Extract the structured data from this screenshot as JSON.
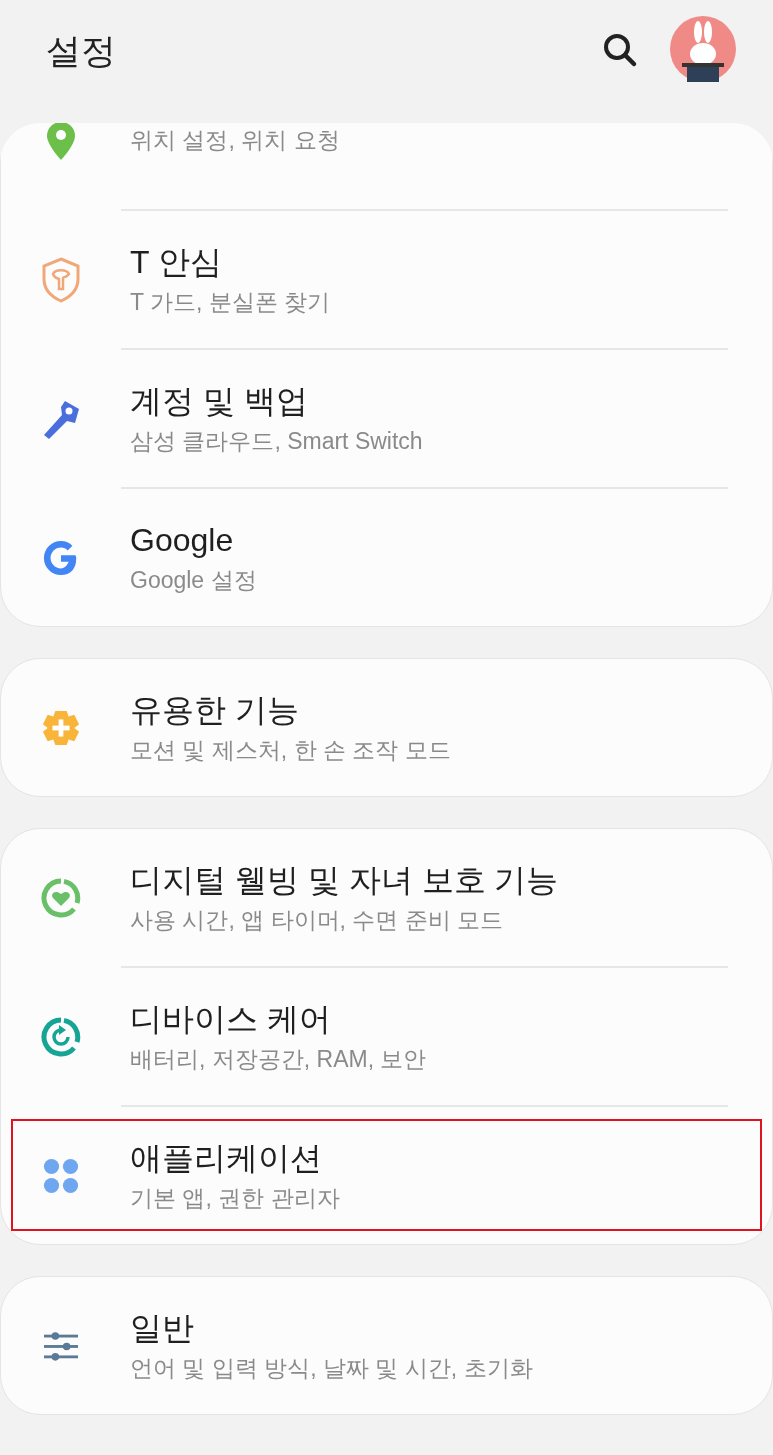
{
  "header": {
    "title": "설정"
  },
  "cards": [
    {
      "items": [
        {
          "kind": "location",
          "subtitle": "위치 설정, 위치 요청",
          "highlighted": false
        },
        {
          "kind": "shield",
          "title": "T 안심",
          "subtitle": "T 가드, 분실폰 찾기",
          "highlighted": false
        },
        {
          "kind": "key",
          "title": "계정 및 백업",
          "subtitle": "삼성 클라우드, Smart Switch",
          "highlighted": false
        },
        {
          "kind": "google",
          "title": "Google",
          "subtitle": "Google 설정",
          "highlighted": false
        }
      ]
    },
    {
      "items": [
        {
          "kind": "gear",
          "title": "유용한 기능",
          "subtitle": "모션 및 제스처, 한 손 조작 모드",
          "highlighted": false
        }
      ]
    },
    {
      "items": [
        {
          "kind": "wellbeing",
          "title": "디지털 웰빙 및 자녀 보호 기능",
          "subtitle": "사용 시간, 앱 타이머, 수면 준비 모드",
          "highlighted": false
        },
        {
          "kind": "care",
          "title": "디바이스 케어",
          "subtitle": "배터리, 저장공간, RAM, 보안",
          "highlighted": false
        },
        {
          "kind": "apps",
          "title": "애플리케이션",
          "subtitle": "기본 앱, 권한 관리자",
          "highlighted": true
        }
      ]
    },
    {
      "items": [
        {
          "kind": "sliders",
          "title": "일반",
          "subtitle": "언어 및 입력 방식, 날짜 및 시간, 초기화",
          "highlighted": false
        }
      ]
    }
  ]
}
